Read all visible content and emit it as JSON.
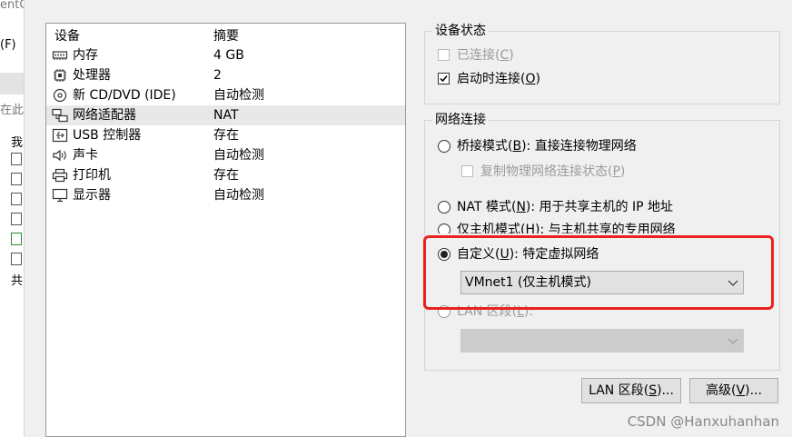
{
  "background_window": {
    "fragments": [
      "entC",
      "(F)",
      "在此",
      "我",
      "共"
    ]
  },
  "device_list": {
    "columns": [
      "设备",
      "摘要"
    ],
    "rows": [
      {
        "icon": "memory-icon",
        "name": "内存",
        "summary": "4 GB"
      },
      {
        "icon": "cpu-icon",
        "name": "处理器",
        "summary": "2"
      },
      {
        "icon": "cd-dvd-icon",
        "name": "新 CD/DVD (IDE)",
        "summary": "自动检测"
      },
      {
        "icon": "network-adapter-icon",
        "name": "网络适配器",
        "summary": "NAT",
        "selected": true
      },
      {
        "icon": "usb-icon",
        "name": "USB 控制器",
        "summary": "存在"
      },
      {
        "icon": "sound-icon",
        "name": "声卡",
        "summary": "自动检测"
      },
      {
        "icon": "printer-icon",
        "name": "打印机",
        "summary": "存在"
      },
      {
        "icon": "display-icon",
        "name": "显示器",
        "summary": "自动检测"
      }
    ]
  },
  "device_status": {
    "title": "设备状态",
    "connected": {
      "label": "已连接(",
      "key": "C",
      "suffix": ")",
      "checked": false,
      "enabled": false
    },
    "connect_at_power_on": {
      "label": "启动时连接(",
      "key": "O",
      "suffix": ")",
      "checked": true,
      "enabled": true
    }
  },
  "network_connection": {
    "title": "网络连接",
    "bridged": {
      "label": "桥接模式(",
      "key": "B",
      "suffix": "): 直接连接物理网络",
      "selected": false
    },
    "replicate": {
      "label": "复制物理网络连接状态(",
      "key": "P",
      "suffix": ")",
      "checked": false,
      "enabled": false
    },
    "nat": {
      "label": "NAT 模式(",
      "key": "N",
      "suffix": "): 用于共享主机的 IP 地址",
      "selected": false
    },
    "host_only": {
      "label": "仅主机模式(",
      "key": "H",
      "suffix": "): 与主机共享的专用网络",
      "selected": false
    },
    "custom": {
      "label": "自定义(",
      "key": "U",
      "suffix": "): 特定虚拟网络",
      "selected": true
    },
    "custom_network": {
      "value": "VMnet1 (仅主机模式)"
    },
    "lan_segment": {
      "label": "LAN 区段(",
      "key": "L",
      "suffix": "):",
      "selected": false
    },
    "lan_segment_select": {
      "value": ""
    }
  },
  "buttons": {
    "lan_segments": {
      "label": "LAN 区段(",
      "key": "S",
      "suffix": ")..."
    },
    "advanced": {
      "label": "高级(",
      "key": "V",
      "suffix": ")..."
    }
  },
  "colors": {
    "highlight": "#e8221f",
    "selected_row": "#e8e8e8"
  },
  "watermark": "CSDN @Hanxuhanhan"
}
